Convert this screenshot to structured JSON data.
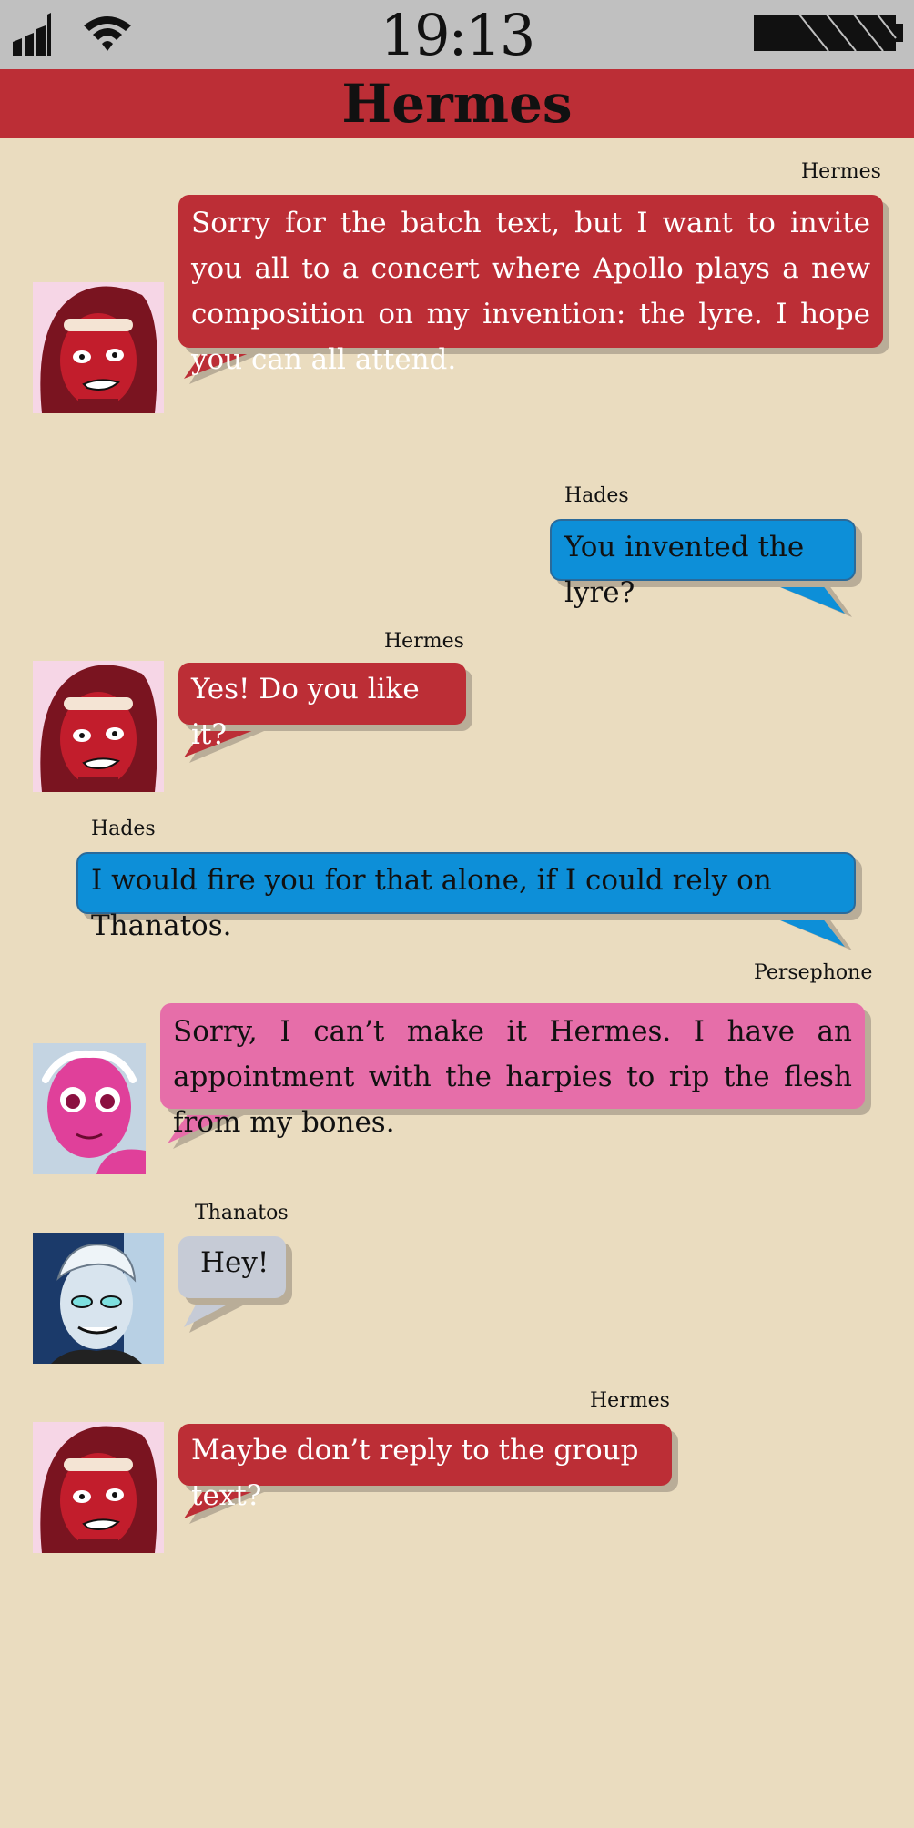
{
  "status": {
    "time": "19:13",
    "signal_icon": "signal-bars-icon",
    "wifi_icon": "wifi-icon",
    "battery_icon": "battery-icon"
  },
  "header": {
    "title": "Hermes"
  },
  "colors": {
    "hermes": "#bc2e36",
    "hades": "#0d8fd8",
    "persephone": "#e66ea9",
    "thanatos": "#c6cbd6",
    "background": "#eadcbf"
  },
  "messages": [
    {
      "sender": "Hermes",
      "text": "Sorry for the batch text, but I want to invite you all to a concert where Apollo plays a new composition on my invention: the lyre. I hope you can all attend."
    },
    {
      "sender": "Hades",
      "text": "You invented the lyre?"
    },
    {
      "sender": "Hermes",
      "text": "Yes! Do you like it?"
    },
    {
      "sender": "Hades",
      "text": "I would fire you for that alone, if I could rely on Thanatos."
    },
    {
      "sender": "Persephone",
      "text": "Sorry, I can’t make it Hermes. I have an appointment with the harpies to rip the flesh from my bones."
    },
    {
      "sender": "Thanatos",
      "text": "Hey!"
    },
    {
      "sender": "Hermes",
      "text": "Maybe don’t reply to the group text?"
    }
  ]
}
